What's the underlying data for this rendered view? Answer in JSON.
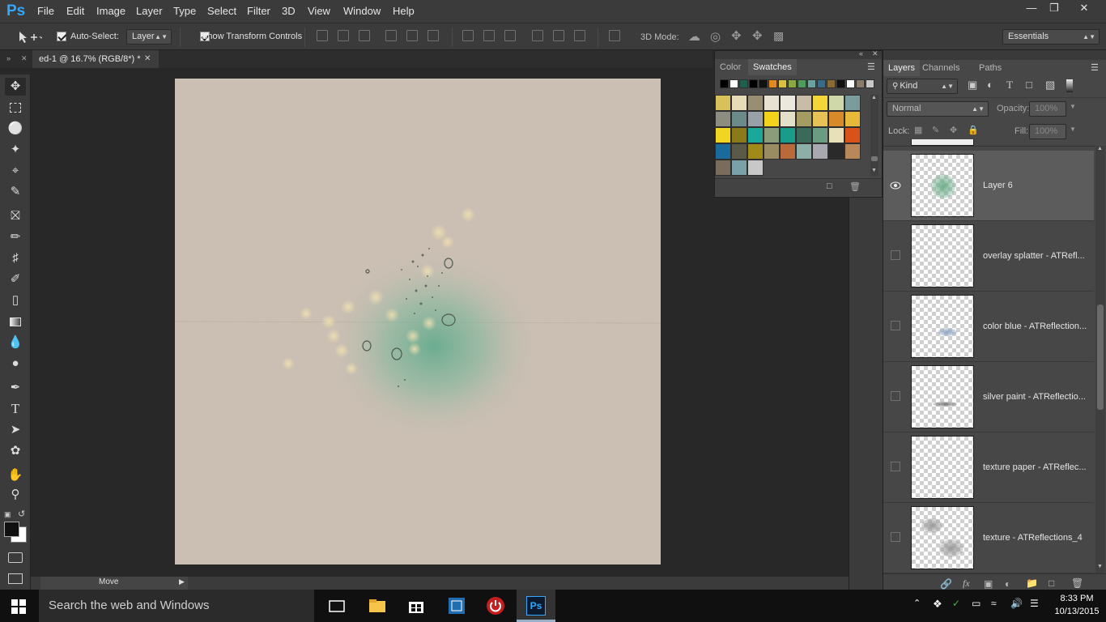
{
  "app": {
    "logo": "Ps",
    "accent": "#31a8ff"
  },
  "menu": [
    "File",
    "Edit",
    "Image",
    "Layer",
    "Type",
    "Select",
    "Filter",
    "3D",
    "View",
    "Window",
    "Help"
  ],
  "window_controls": {
    "minimize": "—",
    "restore": "❐",
    "close": "✕"
  },
  "options": {
    "auto_select_label": "Auto-Select:",
    "auto_select_value": "Layer",
    "show_transform_label": "Show Transform Controls",
    "mode_3d_label": "3D Mode:",
    "workspace_value": "Essentials"
  },
  "document": {
    "tab_title": "ed-1 @ 16.7% (RGB/8*) *",
    "close": "✕",
    "status_label": "Move"
  },
  "swatches_panel": {
    "tabs": [
      "Color",
      "Swatches"
    ],
    "active_tab": "Swatches",
    "top_row": [
      "#000000",
      "#ffffff",
      "#1f5f4d",
      "#000000",
      "#111111",
      "#e08a1e",
      "#d9bf44",
      "#8aa840",
      "#4f9b5b",
      "#6fa0a0",
      "#3a6a86",
      "#8a6b38",
      "#111111",
      "#ffffff",
      "#8a7c6a",
      "#c8c8c8"
    ],
    "grid": [
      [
        "#d8c05a",
        "#e7dcb8",
        "#9a8e72",
        "#e8e2d2",
        "#ece8de",
        "#c8bca8",
        "#f2d63a",
        "#cfd8a8",
        "#7a9c9c"
      ],
      [
        "#8c8c80",
        "#6b8a8a",
        "#9aa0a8",
        "#f2d21a",
        "#e2e0c8",
        "#a49c62",
        "#e6c256",
        "#d88a2a",
        "#e8b838"
      ],
      [
        "#f2d422",
        "#8a7a1a",
        "#1aa89a",
        "#8a9c7a",
        "#1a9c8a",
        "#3a6a5a",
        "#6a9c84",
        "#e8e0b8",
        "#d8521a"
      ],
      [
        "#1a6a9c",
        "#5a5a48",
        "#a08a1a",
        "#9a8c62",
        "#b86a3a",
        "#8cb0a8",
        "#a8a8b0",
        "#2a2a2a",
        "#b8885a"
      ],
      [
        "#7a6c5a",
        "#7aa0a8",
        "#c8c8c8"
      ]
    ]
  },
  "layers_panel": {
    "tabs": [
      "Layers",
      "Channels",
      "Paths"
    ],
    "active_tab": "Layers",
    "filter_value": "Kind",
    "blend_mode": "Normal",
    "opacity_label": "Opacity:",
    "opacity_value": "100%",
    "lock_label": "Lock:",
    "fill_label": "Fill:",
    "fill_value": "100%",
    "layers": [
      {
        "name": "Layer 6",
        "visible": true,
        "selected": true
      },
      {
        "name": "overlay splatter - ATRefl...",
        "visible": false,
        "selected": false
      },
      {
        "name": "color blue - ATReflection...",
        "visible": false,
        "selected": false
      },
      {
        "name": "silver paint - ATReflectio...",
        "visible": false,
        "selected": false
      },
      {
        "name": "texture paper - ATReflec...",
        "visible": false,
        "selected": false
      },
      {
        "name": "texture - ATReflections_4",
        "visible": false,
        "selected": false
      }
    ]
  },
  "taskbar": {
    "search_placeholder": "Search the web and Windows",
    "time": "8:33 PM",
    "date": "10/13/2015"
  }
}
